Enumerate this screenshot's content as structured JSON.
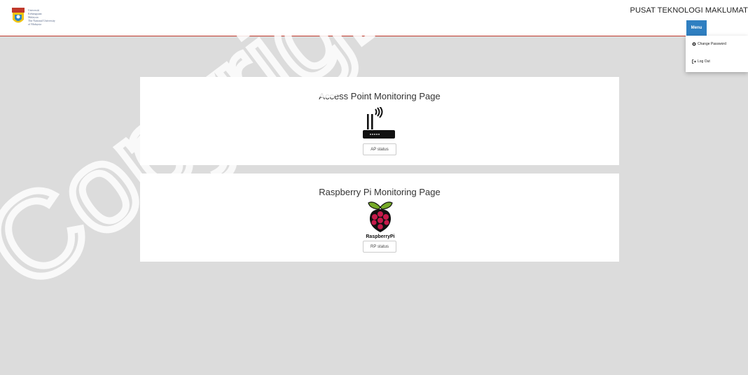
{
  "header": {
    "org_name": "PUSAT TEKNOLOGI MAKLUMAT",
    "logo": {
      "lines": [
        "Universiti",
        "Kebangsaan",
        "Malaysia",
        "The National University",
        "of Malaysia"
      ],
      "icon": "ukm-crest-icon"
    }
  },
  "menu": {
    "label": "Menu",
    "items": [
      {
        "label": "Change Password",
        "icon": "gear-icon"
      },
      {
        "label": "Log Out",
        "icon": "logout-icon"
      }
    ]
  },
  "cards": [
    {
      "title": "Access Point Monitoring Page",
      "icon": "wifi-router-icon",
      "button": "AP status"
    },
    {
      "title": "Raspberry Pi Monitoring Page",
      "icon": "raspberry-pi-logo",
      "logo_text": "RaspberryPi",
      "button": "RP status"
    }
  ],
  "watermark": {
    "text": "Copyright UKM"
  },
  "colors": {
    "background": "#dcdcdc",
    "header_border": "#c0392b",
    "menu_button": "#2f7fc1",
    "raspberry_red": "#c51a4a",
    "raspberry_green": "#75a928"
  }
}
